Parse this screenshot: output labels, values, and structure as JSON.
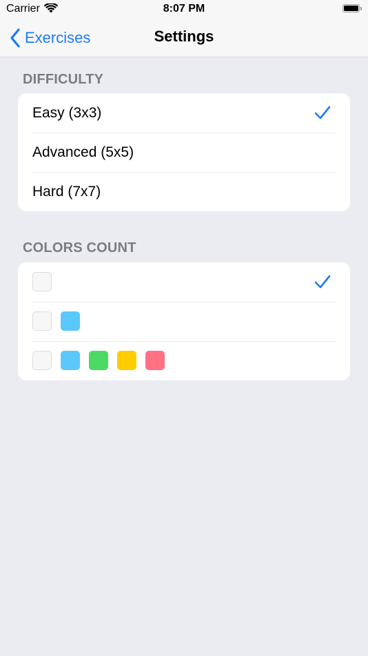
{
  "status_bar": {
    "carrier": "Carrier",
    "time": "8:07 PM"
  },
  "nav": {
    "back_label": "Exercises",
    "title": "Settings"
  },
  "difficulty": {
    "header": "DIFFICULTY",
    "options": [
      {
        "label": "Easy (3x3)",
        "selected": true
      },
      {
        "label": "Advanced (5x5)",
        "selected": false
      },
      {
        "label": "Hard (7x7)",
        "selected": false
      }
    ]
  },
  "colors_count": {
    "header": "COLORS COUNT",
    "options": [
      {
        "swatches": [
          "empty"
        ],
        "selected": true
      },
      {
        "swatches": [
          "empty",
          "#5ac8fa"
        ],
        "selected": false
      },
      {
        "swatches": [
          "empty",
          "#5ac8fa",
          "#4cd964",
          "#ffcc00",
          "#ff7183"
        ],
        "selected": false
      }
    ]
  },
  "colors": {
    "accent": "#1a7cf3",
    "background": "#ebebf2",
    "header_text": "#7c7c80"
  }
}
